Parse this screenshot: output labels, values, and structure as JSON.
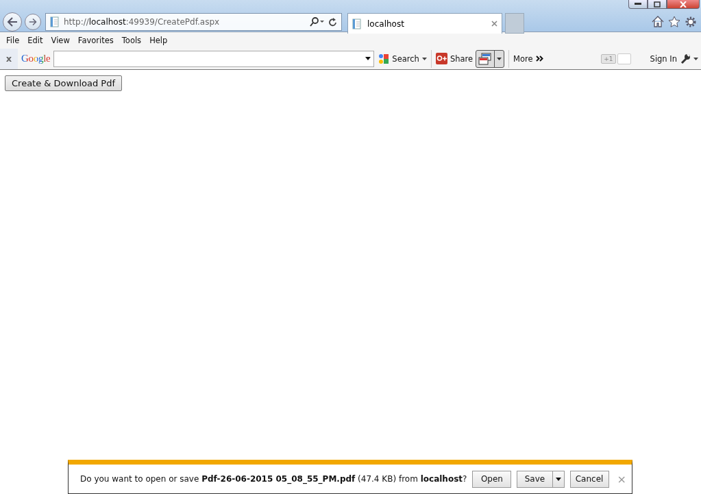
{
  "address": {
    "scheme": "http://",
    "host": "localhost",
    "path": ":49939/CreatePdf.aspx"
  },
  "tabs": [
    {
      "label": "localhost",
      "selected": true
    }
  ],
  "menu": [
    "File",
    "Edit",
    "View",
    "Favorites",
    "Tools",
    "Help"
  ],
  "google_toolbar": {
    "close": "x",
    "logo": "Google",
    "search": "Search",
    "share": "Share",
    "more": "More",
    "plus_one": "+1",
    "sign_in": "Sign In"
  },
  "page": {
    "button": "Create & Download Pdf"
  },
  "download_bar": {
    "message": "Do you want to open or save **Pdf-26-06-2015 05_08_55_PM.pdf** (47.4 KB) from **localhost**?",
    "buttons": [
      {
        "label": "Open",
        "kind": "plain"
      },
      {
        "label": "Save",
        "kind": "split"
      },
      {
        "label": "Cancel",
        "kind": "plain"
      }
    ],
    "close": "×"
  }
}
